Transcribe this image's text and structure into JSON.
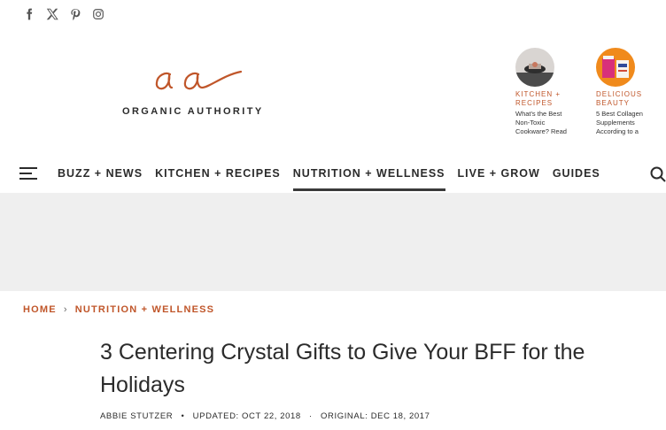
{
  "social": [
    "facebook-icon",
    "x-icon",
    "pinterest-icon",
    "instagram-icon"
  ],
  "brand": {
    "name": "ORGANIC AUTHORITY",
    "mark": "oa",
    "accent": "#c0562a"
  },
  "promos": [
    {
      "category": "KITCHEN + RECIPES",
      "title": "What's the Best Non-Toxic Cookware? Read"
    },
    {
      "category": "DELICIOUS BEAUTY",
      "title": "5 Best Collagen Supplements According to a"
    }
  ],
  "nav": {
    "items": [
      "BUZZ + NEWS",
      "KITCHEN + RECIPES",
      "NUTRITION + WELLNESS",
      "LIVE + GROW",
      "GUIDES"
    ],
    "active": "NUTRITION + WELLNESS"
  },
  "breadcrumb": {
    "home": "HOME",
    "current": "NUTRITION + WELLNESS"
  },
  "article": {
    "title": "3 Centering Crystal Gifts to Give Your BFF for the Holidays",
    "author": "ABBIE STUTZER",
    "updated": "UPDATED: OCT 22, 2018",
    "original": "ORIGINAL: DEC 18, 2017"
  }
}
